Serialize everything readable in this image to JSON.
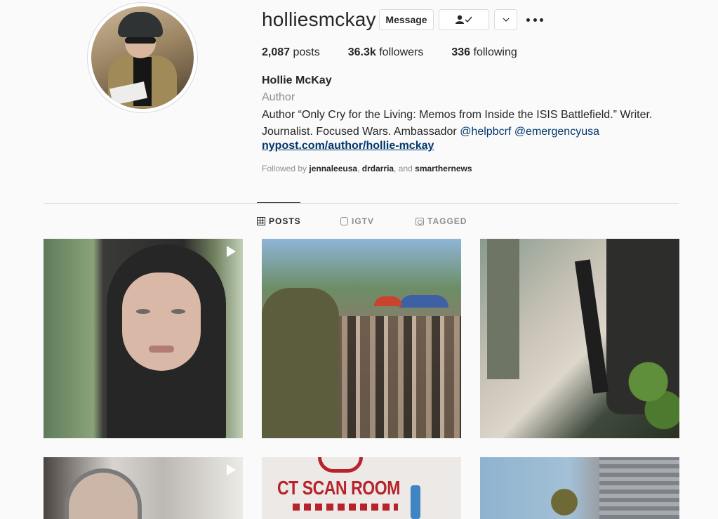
{
  "profile": {
    "username": "holliesmckay",
    "full_name": "Hollie McKay",
    "category": "Author",
    "bio_line1": "Author “Only Cry for the Living: Memos from Inside the ISIS Battlefield.” Writer.",
    "bio_line2_prefix": "Journalist. Focused Wars. Ambassador ",
    "mention1": "@helpbcrf",
    "mention2": "@emergencyusa",
    "website": "nypost.com/author/hollie-mckay",
    "followed_by_label": "Followed by ",
    "followed_by_users": [
      "jennaleeusa",
      "drdarria",
      "smarthernews"
    ],
    "followed_sep1": ", ",
    "followed_sep2": ", and "
  },
  "actions": {
    "message_label": "Message",
    "following_icon": "person-check-icon",
    "dropdown_icon": "chevron-down-icon",
    "more_icon": "more-options-icon"
  },
  "stats": {
    "posts_count": "2,087",
    "posts_label": " posts",
    "followers_count": "36.3k",
    "followers_label": " followers",
    "following_count": "336",
    "following_label": " following"
  },
  "tabs": [
    {
      "label": "POSTS",
      "icon": "grid-icon",
      "active": true
    },
    {
      "label": "IGTV",
      "icon": "igtv-icon",
      "active": false
    },
    {
      "label": "TAGGED",
      "icon": "tagged-icon",
      "active": false
    }
  ],
  "posts": [
    {
      "type": "video",
      "icon": "play-icon"
    },
    {
      "type": "photo"
    },
    {
      "type": "photo"
    },
    {
      "type": "video",
      "icon": "play-icon"
    },
    {
      "type": "photo",
      "sign_text": "CT SCAN ROOM"
    },
    {
      "type": "photo"
    }
  ],
  "colors": {
    "background": "#fafafa",
    "text": "#262626",
    "secondary_text": "#8e8e8e",
    "link": "#00376b",
    "border": "#dbdbdb"
  }
}
